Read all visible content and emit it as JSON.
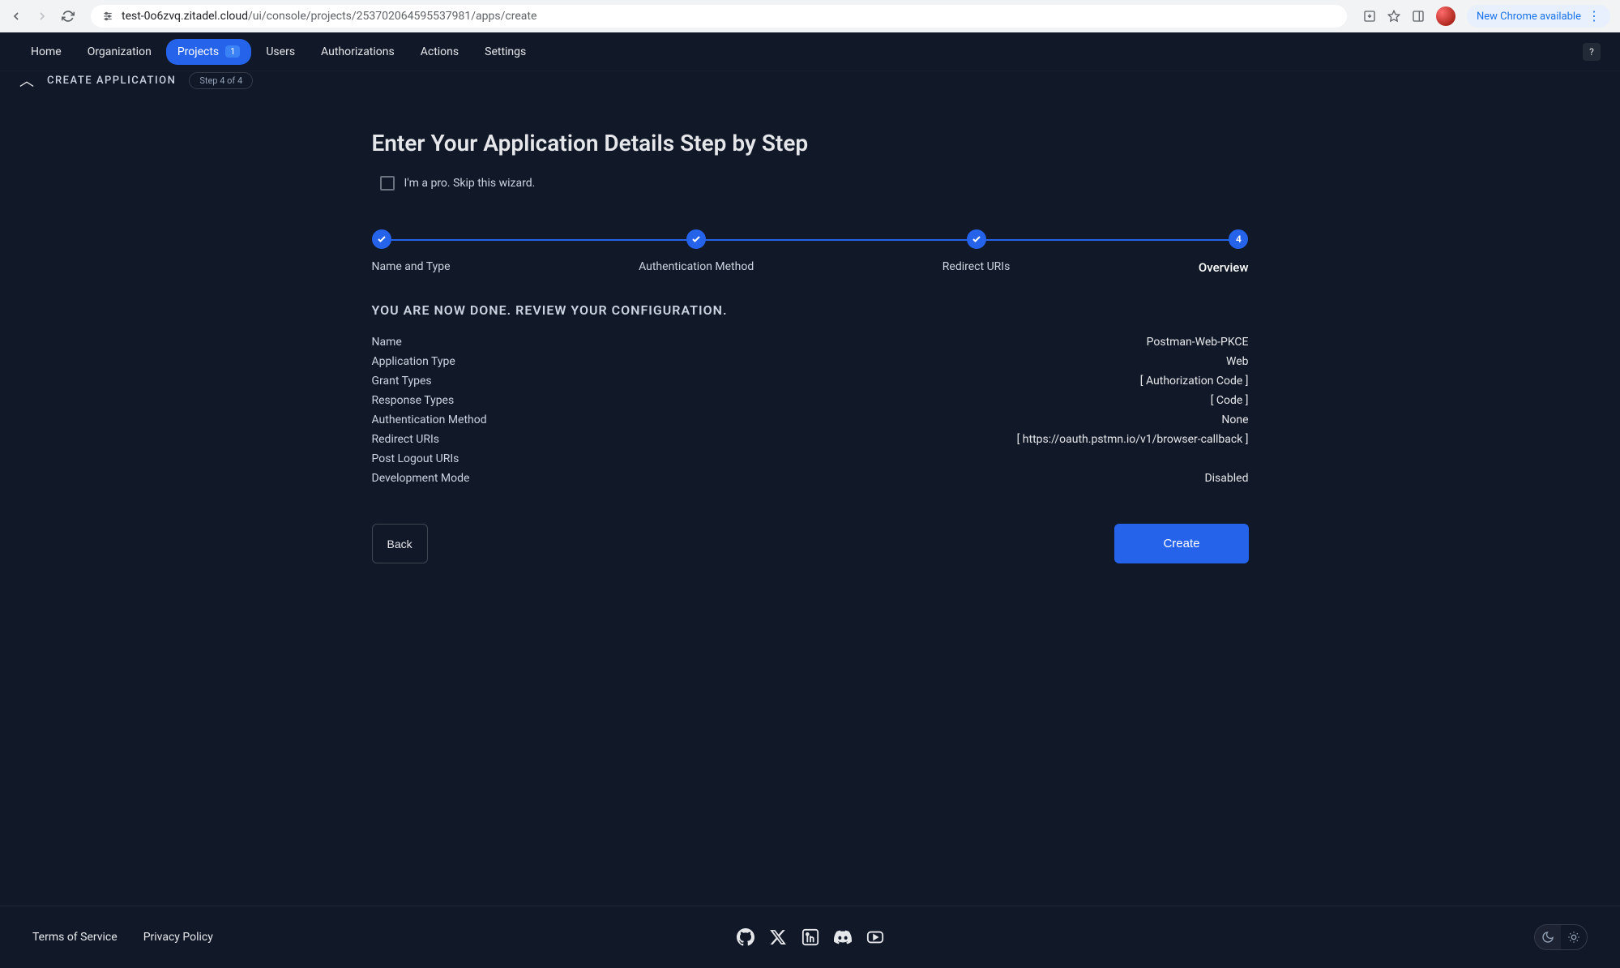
{
  "browser": {
    "url_host": "test-0o6zvq.zitadel.cloud",
    "url_path": "/ui/console/projects/253702064595537981/apps/create",
    "update_label": "New Chrome available"
  },
  "nav": {
    "items": [
      "Home",
      "Organization",
      "Projects",
      "Users",
      "Authorizations",
      "Actions",
      "Settings"
    ],
    "active_index": 2,
    "badge": "1",
    "help": "?"
  },
  "crumb": {
    "title": "CREATE APPLICATION",
    "step_pill": "Step 4 of 4"
  },
  "page": {
    "title": "Enter Your Application Details Step by Step",
    "skip_label": "I'm a pro. Skip this wizard."
  },
  "stepper": {
    "steps": [
      "Name and Type",
      "Authentication Method",
      "Redirect URIs",
      "Overview"
    ],
    "current": 4
  },
  "review": {
    "heading": "YOU ARE NOW DONE. REVIEW YOUR CONFIGURATION.",
    "rows": [
      {
        "key": "Name",
        "val": "Postman-Web-PKCE"
      },
      {
        "key": "Application Type",
        "val": "Web"
      },
      {
        "key": "Grant Types",
        "val": "[ Authorization Code ]"
      },
      {
        "key": "Response Types",
        "val": "[ Code ]"
      },
      {
        "key": "Authentication Method",
        "val": "None"
      },
      {
        "key": "Redirect URIs",
        "val": "[ https://oauth.pstmn.io/v1/browser-callback ]"
      },
      {
        "key": "Post Logout URIs",
        "val": ""
      },
      {
        "key": "Development Mode",
        "val": "Disabled"
      }
    ]
  },
  "actions": {
    "back": "Back",
    "create": "Create"
  },
  "footer": {
    "tos": "Terms of Service",
    "privacy": "Privacy Policy"
  }
}
